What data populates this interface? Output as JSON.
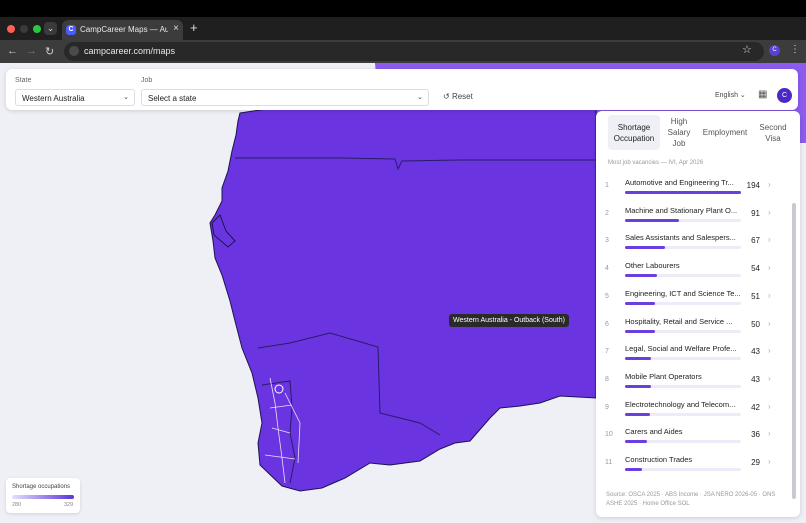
{
  "browser": {
    "tab_title": "CampCareer Maps — Australi",
    "tab_icon_letter": "C",
    "url": "campcareer.com/maps",
    "profile_letter": "C"
  },
  "filters": {
    "state_label": "State",
    "state_value": "Western Australia",
    "job_label": "Job",
    "job_value": "Select a state",
    "reset_label": "Reset",
    "language": "English",
    "avatar_letter": "C"
  },
  "map": {
    "tooltip": "Western Australia - Outback (South)",
    "fill_color": "#6a35e0",
    "sea_color": "#eef0f6"
  },
  "panel": {
    "tabs": [
      {
        "label": "Shortage Occupation",
        "active": true
      },
      {
        "label": "High Salary Job",
        "active": false
      },
      {
        "label": "Employment",
        "active": false
      },
      {
        "label": "Second Visa",
        "active": false
      }
    ],
    "subtitle": "Most job vacancies — IVI, Apr 2026",
    "max_value": 194,
    "rows": [
      {
        "rank": "1",
        "name": "Automotive and Engineering Tr...",
        "count": 194
      },
      {
        "rank": "2",
        "name": "Machine and Stationary Plant O...",
        "count": 91
      },
      {
        "rank": "3",
        "name": "Sales Assistants and Salespers...",
        "count": 67
      },
      {
        "rank": "4",
        "name": "Other Labourers",
        "count": 54
      },
      {
        "rank": "5",
        "name": "Engineering, ICT and Science Te...",
        "count": 51
      },
      {
        "rank": "6",
        "name": "Hospitality, Retail and Service ...",
        "count": 50
      },
      {
        "rank": "7",
        "name": "Legal, Social and Welfare Profe...",
        "count": 43
      },
      {
        "rank": "8",
        "name": "Mobile Plant Operators",
        "count": 43
      },
      {
        "rank": "9",
        "name": "Electrotechnology and Telecom...",
        "count": 42
      },
      {
        "rank": "10",
        "name": "Carers and Aides",
        "count": 36
      },
      {
        "rank": "11",
        "name": "Construction Trades",
        "count": 29
      }
    ],
    "source": "Source: OSCA 2025 · ABS Income · JSA NERO 2026-05 · ONS ASHE 2025 · Home Office SOL"
  },
  "legend": {
    "title": "Shortage occupations",
    "min": "280",
    "max": "329"
  }
}
